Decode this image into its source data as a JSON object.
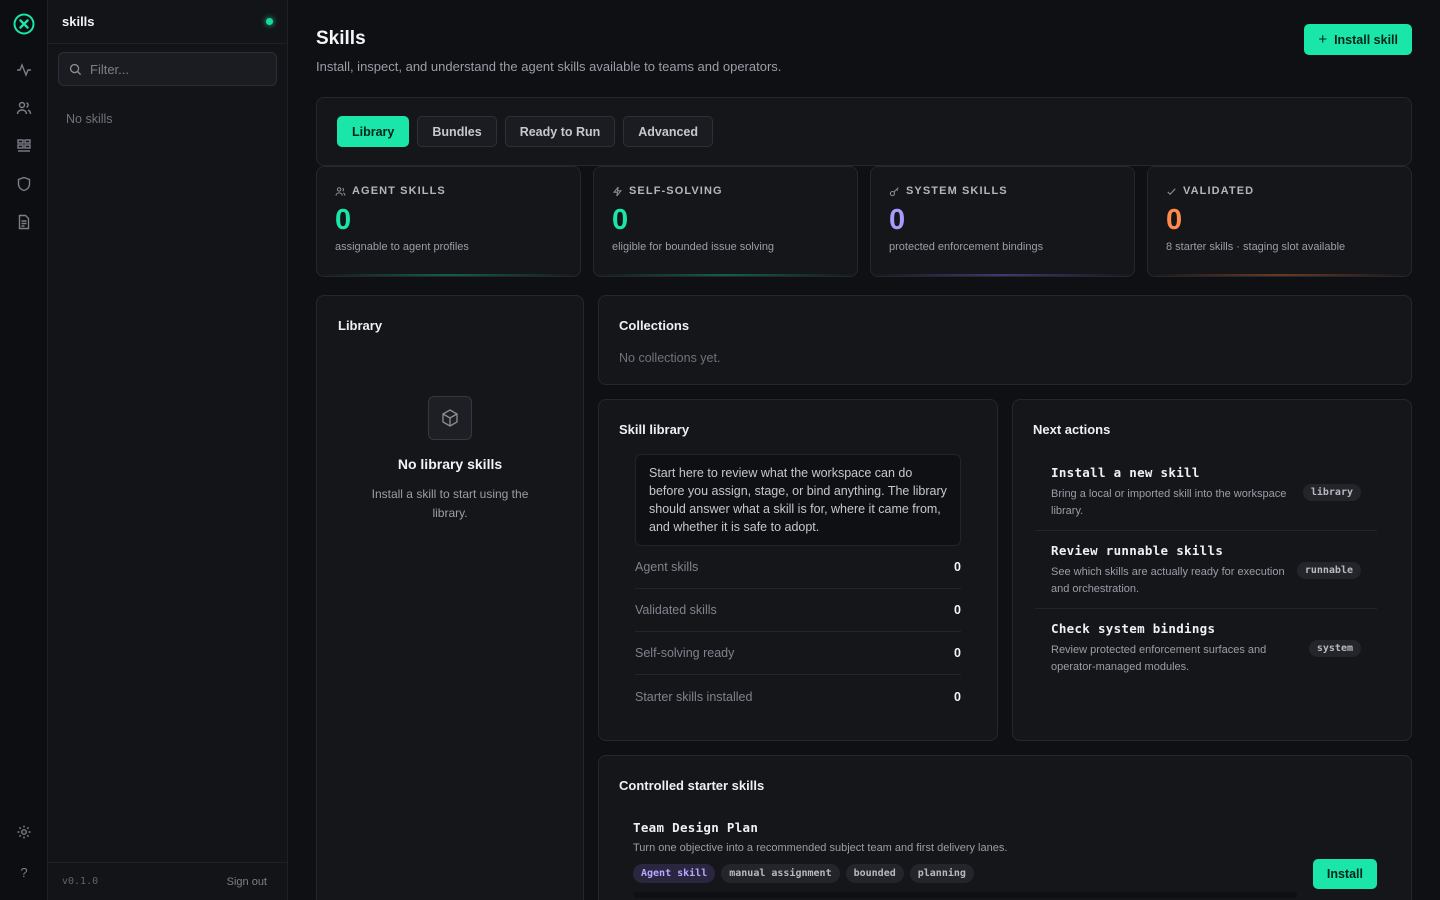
{
  "colors": {
    "accent": "#19e6a8",
    "agent": "#19e6a8",
    "self_solving": "#19e6a8",
    "system": "#a89bff",
    "validated": "#ff8a4c"
  },
  "rail": {
    "logo_icon": "logo-icon",
    "items": [
      "activity-icon",
      "users-icon",
      "grid-icon",
      "shield-icon",
      "file-icon"
    ],
    "settings_icon": "gear-icon",
    "help_label": "?"
  },
  "sidebar": {
    "title": "skills",
    "filter_placeholder": "Filter...",
    "empty_text": "No skills",
    "version": "v0.1.0",
    "signout": "Sign out"
  },
  "header": {
    "title": "Skills",
    "subtitle": "Install, inspect, and understand the agent skills available to teams and operators.",
    "install_label": "Install skill"
  },
  "tabs": [
    {
      "label": "Library",
      "active": true
    },
    {
      "label": "Bundles",
      "active": false
    },
    {
      "label": "Ready to Run",
      "active": false
    },
    {
      "label": "Advanced",
      "active": false
    }
  ],
  "stats": [
    {
      "label": "AGENT SKILLS",
      "value": "0",
      "desc": "assignable to agent profiles",
      "icon": "users-icon"
    },
    {
      "label": "SELF-SOLVING",
      "value": "0",
      "desc": "eligible for bounded issue solving",
      "icon": "bolt-icon"
    },
    {
      "label": "SYSTEM SKILLS",
      "value": "0",
      "desc": "protected enforcement bindings",
      "icon": "key-icon"
    },
    {
      "label": "VALIDATED",
      "value": "0",
      "desc": "8 starter skills · staging slot available",
      "icon": "check-icon"
    }
  ],
  "library": {
    "title": "Library",
    "empty_title": "No library skills",
    "empty_desc": "Install a skill to start using the library."
  },
  "collections": {
    "title": "Collections",
    "empty": "No collections yet."
  },
  "skill_library": {
    "title": "Skill library",
    "note": "Start here to review what the workspace can do before you assign, stage, or bind anything. The library should answer what a skill is for, where it came from, and whether it is safe to adopt.",
    "rows": [
      {
        "label": "Agent skills",
        "value": "0"
      },
      {
        "label": "Validated skills",
        "value": "0"
      },
      {
        "label": "Self-solving ready",
        "value": "0"
      },
      {
        "label": "Starter skills installed",
        "value": "0"
      }
    ]
  },
  "next_actions": {
    "title": "Next actions",
    "items": [
      {
        "title": "Install a new skill",
        "desc": "Bring a local or imported skill into the workspace library.",
        "badge": "library"
      },
      {
        "title": "Review runnable skills",
        "desc": "See which skills are actually ready for execution and orchestration.",
        "badge": "runnable"
      },
      {
        "title": "Check system bindings",
        "desc": "Review protected enforcement surfaces and operator-managed modules.",
        "badge": "system"
      }
    ]
  },
  "starter": {
    "title": "Controlled starter skills",
    "item": {
      "name": "Team Design Plan",
      "desc": "Turn one objective into a recommended subject team and first delivery lanes.",
      "tags": [
        "Agent skill",
        "manual assignment",
        "bounded",
        "planning"
      ],
      "install_label": "Install"
    }
  }
}
